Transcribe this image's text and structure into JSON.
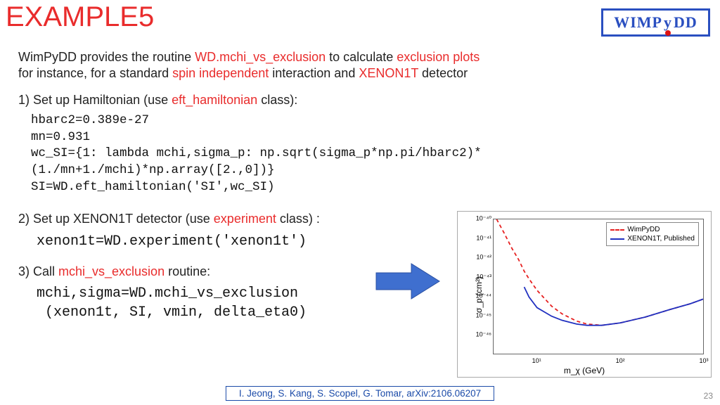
{
  "title": "EXAMPLE5",
  "logo": {
    "left": "WIMP",
    "mid": "y",
    "right": "DD"
  },
  "intro": {
    "prefix": "WimPyDD provides the routine ",
    "routine": "WD.mchi_vs_exclusion",
    "mid1": " to calculate ",
    "exclusion": "exclusion plots",
    "line2a": " for instance, for a standard ",
    "spin": "spin independent",
    "line2b": " interaction and ",
    "detector": "XENON1T",
    "line2c": " detector"
  },
  "steps": {
    "s1a": "1) Set up Hamiltonian (use ",
    "s1b": "eft_hamiltonian",
    "s1c": " class):",
    "s2a": "2) Set up XENON1T detector (use ",
    "s2b": "experiment",
    "s2c": " class) :",
    "s3a": "3) Call ",
    "s3b": "mchi_vs_exclusion",
    "s3c": " routine:"
  },
  "code1": "hbarc2=0.389e-27\nmn=0.931\nwc_SI={1: lambda mchi,sigma_p: np.sqrt(sigma_p*np.pi/hbarc2)*\n(1./mn+1./mchi)*np.array([2.,0])}\nSI=WD.eft_hamiltonian('SI',wc_SI)",
  "code2": "xenon1t=WD.experiment('xenon1t')",
  "code3": "mchi,sigma=WD.mchi_vs_exclusion\n (xenon1t, SI, vmin, delta_eta0)",
  "chart_data": {
    "type": "line",
    "xlabel": "m_χ (GeV)",
    "ylabel": "σ_p (cm²)",
    "xscale": "log",
    "yscale": "log",
    "xlim": [
      3,
      1000
    ],
    "ylim": [
      1e-47,
      1e-40
    ],
    "xticks": [
      10,
      100,
      1000
    ],
    "xtick_labels": [
      "10¹",
      "10²",
      "10³"
    ],
    "yticks": [
      1e-46,
      1e-45,
      1e-44,
      1e-43,
      1e-42,
      1e-41,
      1e-40
    ],
    "ytick_labels": [
      "10⁻⁴⁶",
      "10⁻⁴⁵",
      "10⁻⁴⁴",
      "10⁻⁴³",
      "10⁻⁴²",
      "10⁻⁴¹",
      "10⁻⁴⁰"
    ],
    "series": [
      {
        "name": "WimPyDD",
        "style": "dashed",
        "color": "#e62020",
        "x": [
          3,
          4,
          5,
          6,
          7,
          8,
          10,
          15,
          20,
          30,
          40,
          60,
          100,
          200,
          400,
          700,
          1000
        ],
        "y": [
          2e-40,
          2e-41,
          3e-42,
          8e-43,
          2e-43,
          8e-44,
          2e-44,
          3e-45,
          1.2e-45,
          5e-46,
          3.5e-46,
          3e-46,
          4e-46,
          8e-46,
          2e-45,
          4e-45,
          7e-45
        ]
      },
      {
        "name": "XENON1T, Published",
        "style": "solid",
        "color": "#2030c0",
        "x": [
          7,
          8,
          10,
          15,
          20,
          30,
          40,
          60,
          100,
          200,
          400,
          700,
          1000
        ],
        "y": [
          3e-44,
          9e-45,
          2.5e-45,
          9e-46,
          5.5e-46,
          3.5e-46,
          3e-46,
          3e-46,
          4e-46,
          8e-46,
          2e-45,
          4e-45,
          7e-45
        ]
      }
    ],
    "legend": {
      "position": "upper right"
    }
  },
  "credits": {
    "names": "I. Jeong, S. Kang, S. Scopel, G. Tomar",
    "sep": ", ",
    "arxiv": "arXiv:2106.06207"
  },
  "pagenum": "23"
}
